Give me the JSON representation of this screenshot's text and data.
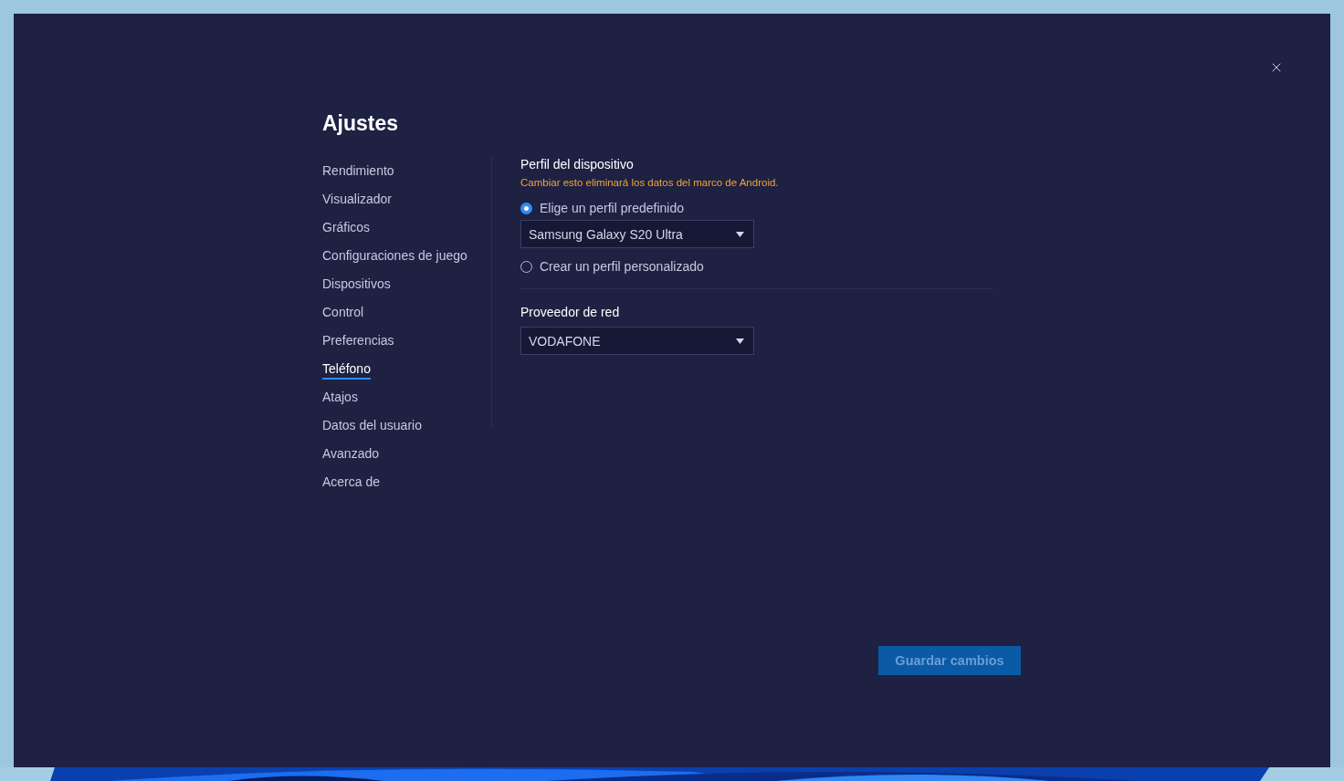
{
  "dialog": {
    "title": "Ajustes",
    "sidebar": {
      "items": [
        {
          "label": "Rendimiento",
          "selected": false
        },
        {
          "label": "Visualizador",
          "selected": false
        },
        {
          "label": "Gráficos",
          "selected": false
        },
        {
          "label": "Configuraciones de juego",
          "selected": false
        },
        {
          "label": "Dispositivos",
          "selected": false
        },
        {
          "label": "Control",
          "selected": false
        },
        {
          "label": "Preferencias",
          "selected": false
        },
        {
          "label": "Teléfono",
          "selected": true
        },
        {
          "label": "Atajos",
          "selected": false
        },
        {
          "label": "Datos del usuario",
          "selected": false
        },
        {
          "label": "Avanzado",
          "selected": false
        },
        {
          "label": "Acerca de",
          "selected": false
        }
      ]
    },
    "device_profile": {
      "title": "Perfil del dispositivo",
      "warning": "Cambiar esto eliminará los datos del marco de Android.",
      "options": [
        {
          "label": "Elige un perfil predefinido",
          "selected": true,
          "dropdown": {
            "value": "Samsung Galaxy S20 Ultra"
          }
        },
        {
          "label": "Crear un perfil personalizado",
          "selected": false
        }
      ]
    },
    "network": {
      "title": "Proveedor de red",
      "dropdown": {
        "value": "VODAFONE"
      }
    },
    "save_button": {
      "label": "Guardar cambios",
      "disabled": true
    }
  }
}
